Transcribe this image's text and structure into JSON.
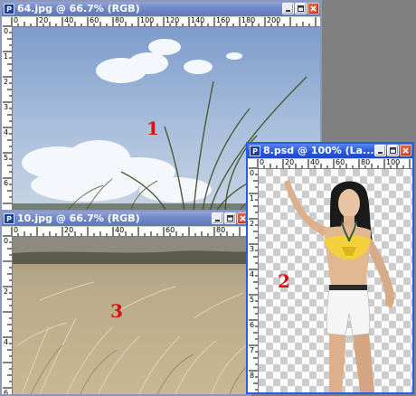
{
  "windows": {
    "sky": {
      "title": "64.jpg @ 66.7% (RGB)",
      "ruler_top": [
        "0",
        "20",
        "40",
        "60",
        "80",
        "100",
        "120",
        "140",
        "160",
        "180",
        "200"
      ],
      "ruler_left": [
        "0",
        "1",
        "2",
        "3",
        "4",
        "5",
        "6",
        "7",
        "8"
      ]
    },
    "model": {
      "title": "8.psd @ 100% (La...",
      "ruler_top": [
        "0",
        "20",
        "40",
        "60",
        "80",
        "100",
        "120"
      ],
      "ruler_left": [
        "0",
        "1",
        "2",
        "3",
        "4",
        "5",
        "6",
        "7",
        "8"
      ]
    },
    "field": {
      "title": "10.jpg @ 66.7% (RGB)",
      "ruler_top": [
        "0",
        "20",
        "40",
        "60",
        "80"
      ],
      "ruler_left": [
        "0",
        "1",
        "2",
        "3",
        "4",
        "5",
        "6",
        "7",
        "8"
      ]
    }
  },
  "markers": {
    "one": "1",
    "two": "2",
    "three": "3"
  },
  "colors": {
    "active_title": "#2a5be0",
    "inactive_title": "#6f86c6",
    "marker": "#d21414"
  },
  "icons": [
    "photoshop-doc-icon",
    "minimize-icon",
    "maximize-icon",
    "close-icon"
  ]
}
